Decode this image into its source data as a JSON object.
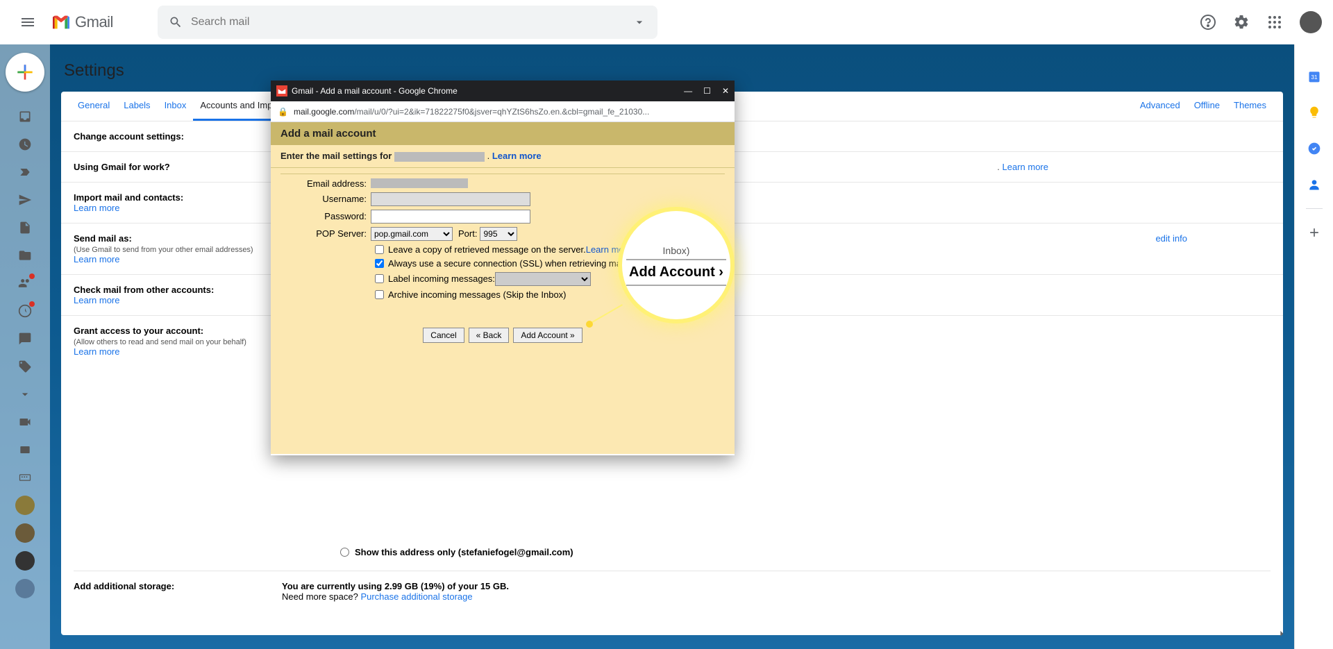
{
  "topbar": {
    "logo_text": "Gmail",
    "search_placeholder": "Search mail"
  },
  "page": {
    "title": "Settings"
  },
  "tabs": [
    "General",
    "Labels",
    "Inbox",
    "Accounts and Import",
    "Advanced",
    "Offline",
    "Themes"
  ],
  "active_tab_index": 3,
  "sections": {
    "change_account": {
      "label": "Change account settings:"
    },
    "using_work": {
      "label": "Using Gmail for work?",
      "trailing": "Learn more"
    },
    "import": {
      "label": "Import mail and contacts:",
      "learn": "Learn more"
    },
    "send_as": {
      "label": "Send mail as:",
      "sub": "(Use Gmail to send from your other email addresses)",
      "learn": "Learn more",
      "edit": "edit info"
    },
    "check_mail": {
      "label": "Check mail from other accounts:",
      "learn": "Learn more"
    },
    "grant_access": {
      "label": "Grant access to your account:",
      "sub": "(Allow others to read and send mail on your behalf)",
      "learn": "Learn more"
    },
    "show_address": {
      "label": "Show this address only (stefaniefogel@gmail.com)"
    },
    "storage": {
      "label": "Add additional storage:",
      "line1": "You are currently using 2.99 GB (19%) of your 15 GB.",
      "line2_a": "Need more space? ",
      "line2_b": "Purchase additional storage"
    }
  },
  "dialog": {
    "window_title": "Gmail - Add a mail account - Google Chrome",
    "url_host": "mail.google.com",
    "url_path": "/mail/u/0/?ui=2&ik=71822275f0&jsver=qhYZtS6hsZo.en.&cbl=gmail_fe_21030...",
    "header": "Add a mail account",
    "subheader_prefix": "Enter the mail settings for ",
    "subheader_suffix": ". ",
    "learn_more": "Learn more",
    "fields": {
      "email_label": "Email address:",
      "username_label": "Username:",
      "password_label": "Password:",
      "pop_label": "POP Server:",
      "pop_value": "pop.gmail.com",
      "port_label": "Port:",
      "port_value": "995"
    },
    "checks": {
      "leave_copy": "Leave a copy of retrieved message on the server. ",
      "ssl": "Always use a secure connection (SSL) when retrieving mail. ",
      "label_incoming": "Label incoming messages: ",
      "archive": "Archive incoming messages (Skip the Inbox)"
    },
    "buttons": {
      "cancel": "Cancel",
      "back": "« Back",
      "add": "Add Account »"
    }
  },
  "magnifier": {
    "top": "Inbox)",
    "main": "Add Account ›"
  }
}
